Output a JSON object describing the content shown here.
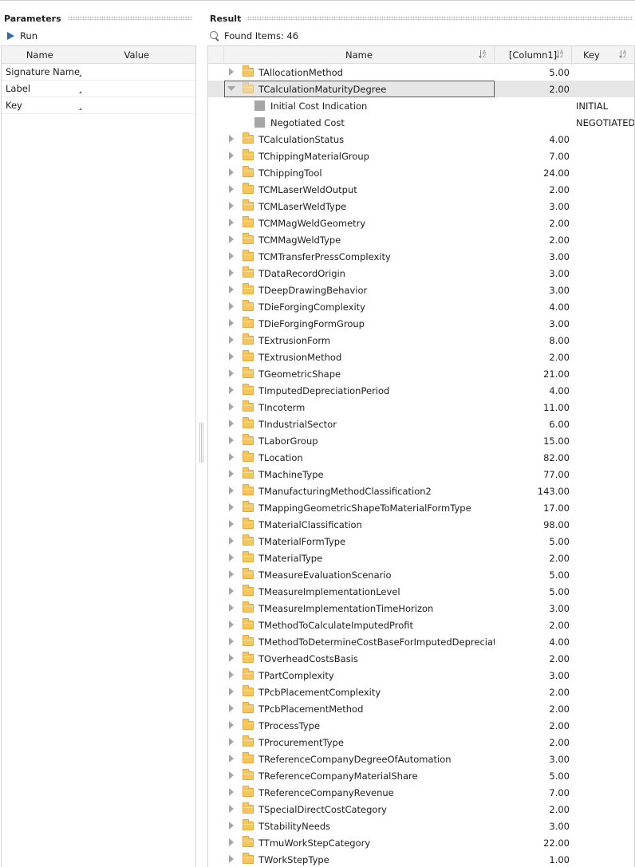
{
  "left_panel": {
    "title": "Parameters",
    "run_label": "Run",
    "columns": {
      "name": "Name",
      "value": "Value"
    },
    "rows": [
      {
        "name": "Signature Name",
        "value": ""
      },
      {
        "name": "Label",
        "value": ""
      },
      {
        "name": "Key",
        "value": ""
      }
    ]
  },
  "right_panel": {
    "title": "Result",
    "found_label": "Found Items: 46",
    "columns": {
      "name": "Name",
      "col1": "[Column1]",
      "key": "Key"
    },
    "rows": [
      {
        "name": "TAllocationMethod",
        "value": "5.00",
        "key": ""
      },
      {
        "name": "TCalculationMaturityDegree",
        "value": "2.00",
        "key": "",
        "expanded": true,
        "selected": true,
        "children": [
          {
            "name": "Initial Cost Indication",
            "value": "",
            "key": "INITIAL"
          },
          {
            "name": "Negotiated Cost",
            "value": "",
            "key": "NEGOTIATED"
          }
        ]
      },
      {
        "name": "TCalculationStatus",
        "value": "4.00",
        "key": ""
      },
      {
        "name": "TChippingMaterialGroup",
        "value": "7.00",
        "key": ""
      },
      {
        "name": "TChippingTool",
        "value": "24.00",
        "key": ""
      },
      {
        "name": "TCMLaserWeldOutput",
        "value": "2.00",
        "key": ""
      },
      {
        "name": "TCMLaserWeldType",
        "value": "3.00",
        "key": ""
      },
      {
        "name": "TCMMagWeldGeometry",
        "value": "2.00",
        "key": ""
      },
      {
        "name": "TCMMagWeldType",
        "value": "2.00",
        "key": ""
      },
      {
        "name": "TCMTransferPressComplexity",
        "value": "3.00",
        "key": ""
      },
      {
        "name": "TDataRecordOrigin",
        "value": "3.00",
        "key": ""
      },
      {
        "name": "TDeepDrawingBehavior",
        "value": "3.00",
        "key": ""
      },
      {
        "name": "TDieForgingComplexity",
        "value": "4.00",
        "key": ""
      },
      {
        "name": "TDieForgingFormGroup",
        "value": "3.00",
        "key": ""
      },
      {
        "name": "TExtrusionForm",
        "value": "8.00",
        "key": ""
      },
      {
        "name": "TExtrusionMethod",
        "value": "2.00",
        "key": ""
      },
      {
        "name": "TGeometricShape",
        "value": "21.00",
        "key": ""
      },
      {
        "name": "TImputedDepreciationPeriod",
        "value": "4.00",
        "key": ""
      },
      {
        "name": "TIncoterm",
        "value": "11.00",
        "key": ""
      },
      {
        "name": "TIndustrialSector",
        "value": "6.00",
        "key": ""
      },
      {
        "name": "TLaborGroup",
        "value": "15.00",
        "key": ""
      },
      {
        "name": "TLocation",
        "value": "82.00",
        "key": ""
      },
      {
        "name": "TMachineType",
        "value": "77.00",
        "key": ""
      },
      {
        "name": "TManufacturingMethodClassification2",
        "value": "143.00",
        "key": ""
      },
      {
        "name": "TMappingGeometricShapeToMaterialFormType",
        "value": "17.00",
        "key": ""
      },
      {
        "name": "TMaterialClassification",
        "value": "98.00",
        "key": ""
      },
      {
        "name": "TMaterialFormType",
        "value": "5.00",
        "key": ""
      },
      {
        "name": "TMaterialType",
        "value": "2.00",
        "key": ""
      },
      {
        "name": "TMeasureEvaluationScenario",
        "value": "5.00",
        "key": ""
      },
      {
        "name": "TMeasureImplementationLevel",
        "value": "5.00",
        "key": ""
      },
      {
        "name": "TMeasureImplementationTimeHorizon",
        "value": "3.00",
        "key": ""
      },
      {
        "name": "TMethodToCalculateImputedProfit",
        "value": "2.00",
        "key": ""
      },
      {
        "name": "TMethodToDetermineCostBaseForImputedDepreciation",
        "value": "4.00",
        "key": ""
      },
      {
        "name": "TOverheadCostsBasis",
        "value": "2.00",
        "key": ""
      },
      {
        "name": "TPartComplexity",
        "value": "3.00",
        "key": ""
      },
      {
        "name": "TPcbPlacementComplexity",
        "value": "2.00",
        "key": ""
      },
      {
        "name": "TPcbPlacementMethod",
        "value": "2.00",
        "key": ""
      },
      {
        "name": "TProcessType",
        "value": "2.00",
        "key": ""
      },
      {
        "name": "TProcurementType",
        "value": "2.00",
        "key": ""
      },
      {
        "name": "TReferenceCompanyDegreeOfAutomation",
        "value": "3.00",
        "key": ""
      },
      {
        "name": "TReferenceCompanyMaterialShare",
        "value": "5.00",
        "key": ""
      },
      {
        "name": "TReferenceCompanyRevenue",
        "value": "7.00",
        "key": ""
      },
      {
        "name": "TSpecialDirectCostCategory",
        "value": "2.00",
        "key": ""
      },
      {
        "name": "TStabilityNeeds",
        "value": "3.00",
        "key": ""
      },
      {
        "name": "TTmuWorkStepCategory",
        "value": "22.00",
        "key": ""
      },
      {
        "name": "TWorkStepType",
        "value": "1.00",
        "key": ""
      }
    ]
  },
  "icons": {
    "run": "play-icon",
    "search": "search-icon",
    "folder": "folder-icon",
    "leaf": "item-square-icon",
    "sort": "sort-az-icon"
  },
  "colors": {
    "accent_blue": "#2b6cb5",
    "folder": "#f6c65b",
    "selection_border": "#c92c2c",
    "selection_bg": "#e6e6e6"
  }
}
